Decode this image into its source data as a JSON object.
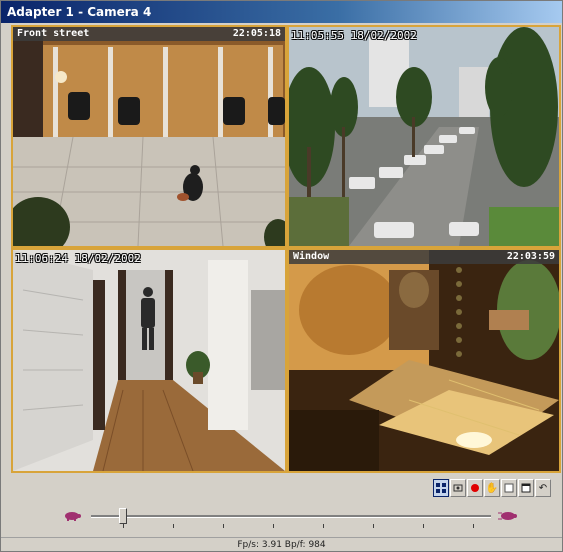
{
  "window": {
    "title": "Adapter 1 - Camera 4"
  },
  "cameras": [
    {
      "name": "Front street",
      "time": "22:05:18",
      "stamp": ""
    },
    {
      "name": "",
      "time": "",
      "stamp": "11:05:55 18/02/2002"
    },
    {
      "name": "",
      "time": "",
      "stamp": "11:06:24 18/02/2002"
    },
    {
      "name": "Window",
      "time": "22:03:59",
      "stamp": ""
    }
  ],
  "toolbar": {
    "buttons": [
      {
        "icon": "quad-view-icon",
        "active": true
      },
      {
        "icon": "camera-select-icon",
        "active": false
      },
      {
        "icon": "record-icon",
        "active": false,
        "color": "#e00000"
      },
      {
        "icon": "hand-icon",
        "active": false
      },
      {
        "icon": "blank-frame-icon",
        "active": false
      },
      {
        "icon": "window-icon",
        "active": false
      },
      {
        "icon": "arrow-back-icon",
        "active": false
      }
    ]
  },
  "playback": {
    "slow_icon": "turtle-slow-icon",
    "fast_icon": "turtle-fast-icon",
    "position": 0.08
  },
  "status": {
    "text": "Fp/s: 3.91  Bp/f: 984"
  },
  "colors": {
    "grid_border": "#d8a43a",
    "title_start": "#0a246a"
  }
}
